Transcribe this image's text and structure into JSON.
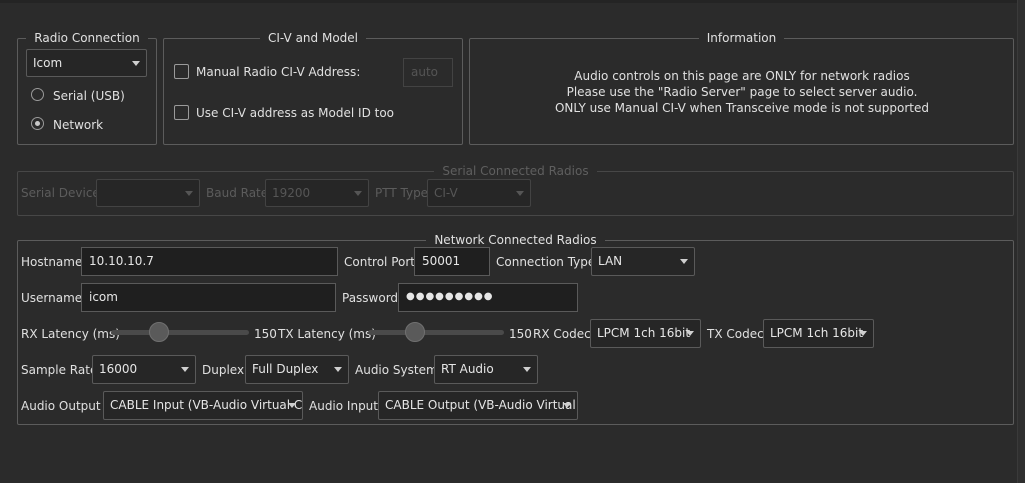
{
  "radio_connection": {
    "title": "Radio Connection",
    "manufacturer": "Icom",
    "options": [
      {
        "label": "Serial (USB)",
        "selected": false
      },
      {
        "label": "Network",
        "selected": true
      }
    ]
  },
  "civ": {
    "title": "CI-V and Model",
    "manual_label": "Manual Radio CI-V Address:",
    "manual_checked": false,
    "address_placeholder": "auto",
    "model_label": "Use CI-V address as Model ID too",
    "model_checked": false
  },
  "information": {
    "title": "Information",
    "lines": [
      "Audio controls on this page are ONLY for network radios",
      "Please use the \"Radio Server\" page to select server audio.",
      "ONLY use Manual CI-V when Transceive mode is not supported"
    ]
  },
  "serial": {
    "title": "Serial Connected Radios",
    "device_label": "Serial Device:",
    "device_value": "",
    "baud_label": "Baud Rate",
    "baud_value": "19200",
    "ptt_label": "PTT Type",
    "ptt_value": "CI-V"
  },
  "network": {
    "title": "Network Connected Radios",
    "hostname_label": "Hostname",
    "hostname_value": "10.10.10.7",
    "control_port_label": "Control Port",
    "control_port_value": "50001",
    "connection_type_label": "Connection Type",
    "connection_type_value": "LAN",
    "username_label": "Username",
    "username_value": "icom",
    "password_label": "Password",
    "password_value": "●●●●●●●●●",
    "rx_latency_label": "RX Latency (ms)",
    "rx_latency_value": "150",
    "rx_latency_fraction": 0.32,
    "tx_latency_label": "TX Latency (ms)",
    "tx_latency_value": "150",
    "tx_latency_fraction": 0.32,
    "rx_codec_label": "RX Codec",
    "rx_codec_value": "LPCM 1ch 16bit",
    "tx_codec_label": "TX Codec",
    "tx_codec_value": "LPCM 1ch 16bit",
    "sample_rate_label": "Sample Rate",
    "sample_rate_value": "16000",
    "duplex_label": "Duplex",
    "duplex_value": "Full Duplex",
    "audio_system_label": "Audio System",
    "audio_system_value": "RT Audio",
    "audio_output_label": "Audio Output",
    "audio_output_value": "CABLE Input (VB-Audio Virtual C",
    "audio_input_label": "Audio Input",
    "audio_input_value": "CABLE Output (VB-Audio Virtual"
  }
}
